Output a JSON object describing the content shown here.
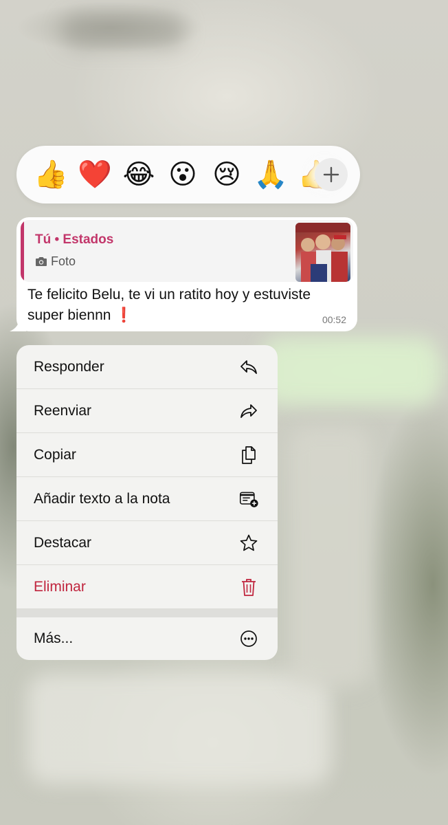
{
  "reactions": {
    "emojis": [
      {
        "name": "thumbs-up",
        "char": "👍"
      },
      {
        "name": "red-heart",
        "char": "❤️"
      },
      {
        "name": "tears-of-joy",
        "char": "😂"
      },
      {
        "name": "surprised",
        "char": "😮"
      },
      {
        "name": "crying",
        "char": "😢"
      },
      {
        "name": "folded-hands",
        "char": "🙏"
      },
      {
        "name": "thumbs-up-partial",
        "char": "👍"
      }
    ],
    "more_icon": "plus-icon"
  },
  "message": {
    "quote_title": "Tú • Estados",
    "quote_sub": "Foto",
    "quote_icon": "camera-icon",
    "text": "Te felicito Belu, te vi un ratito hoy y estuviste super biennn ❗",
    "time": "00:52"
  },
  "menu": {
    "items": [
      {
        "label": "Responder",
        "icon": "reply-icon"
      },
      {
        "label": "Reenviar",
        "icon": "forward-icon"
      },
      {
        "label": "Copiar",
        "icon": "copy-icon"
      },
      {
        "label": "Añadir texto a la nota",
        "icon": "add-note-icon"
      },
      {
        "label": "Destacar",
        "icon": "star-icon"
      },
      {
        "label": "Eliminar",
        "icon": "trash-icon"
      }
    ],
    "more": {
      "label": "Más...",
      "icon": "more-icon"
    }
  },
  "colors": {
    "accent": "#c2366a",
    "danger": "#c0253e",
    "menu_bg": "#f3f3f1"
  }
}
